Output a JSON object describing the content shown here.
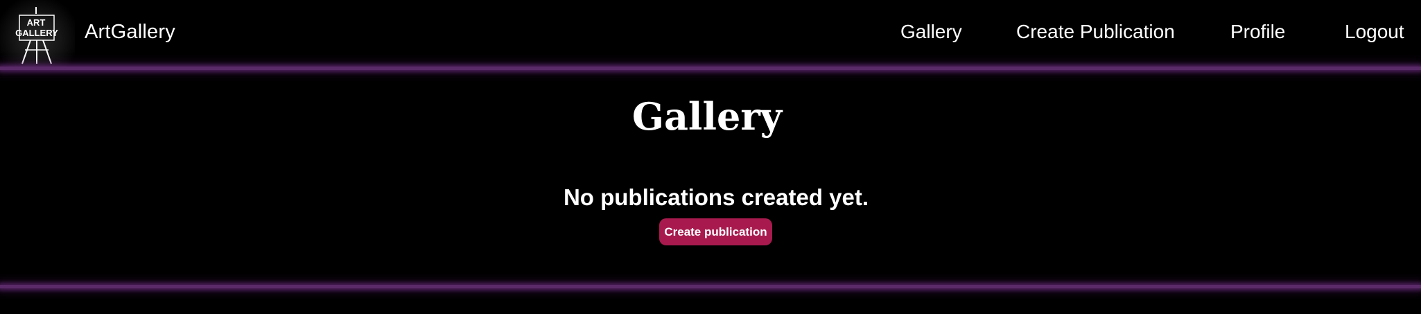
{
  "logo": {
    "line1": "ART",
    "line2": "GALLERY",
    "icon": "easel-icon"
  },
  "header": {
    "brand": "ArtGallery",
    "nav": {
      "gallery": "Gallery",
      "create_publication": "Create Publication",
      "profile": "Profile",
      "logout": "Logout"
    }
  },
  "main": {
    "title": "Gallery",
    "empty_message": "No publications created yet.",
    "create_button": "Create publication"
  },
  "colors": {
    "background": "#000000",
    "divider_glow": "#5a2a68",
    "button": "#a81a4d",
    "text": "#ffffff"
  }
}
